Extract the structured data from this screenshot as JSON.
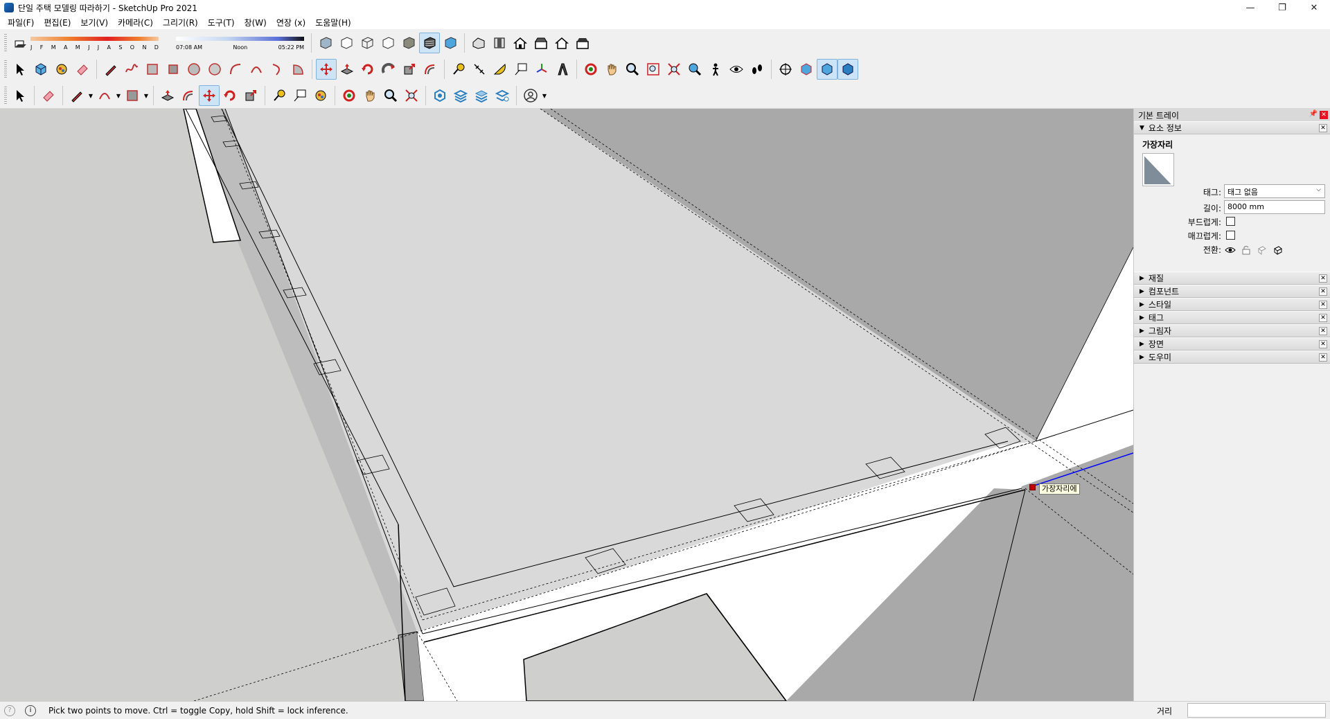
{
  "window": {
    "title": "단일 주택 모델링 따라하기 - SketchUp Pro 2021",
    "controls": {
      "minimize": "—",
      "restore": "❐",
      "close": "✕"
    }
  },
  "menu": [
    "파일(F)",
    "편집(E)",
    "보기(V)",
    "카메라(C)",
    "그리기(R)",
    "도구(T)",
    "창(W)",
    "연장 (x)",
    "도움말(H)"
  ],
  "shadow": {
    "months": [
      "J",
      "F",
      "M",
      "A",
      "M",
      "J",
      "J",
      "A",
      "S",
      "O",
      "N",
      "D"
    ],
    "time_start": "07:08 AM",
    "time_mid": "Noon",
    "time_end": "05:22 PM"
  },
  "tray": {
    "title": "기본 트레이",
    "entity_info": {
      "header": "요소 정보",
      "name": "가장자리",
      "tag_label": "태그:",
      "tag_value": "태그 없음",
      "length_label": "길이:",
      "length_value": "8000 mm",
      "soften_label": "부드럽게:",
      "smooth_label": "매끄럽게:",
      "toggle_label": "전환:"
    },
    "panels": [
      "재질",
      "컴포넌트",
      "스타일",
      "태그",
      "그림자",
      "장면",
      "도우미"
    ]
  },
  "viewport": {
    "inference_tooltip": "가장자리에"
  },
  "status": {
    "message": "Pick two points to move.  Ctrl = toggle Copy, hold Shift = lock inference.",
    "measurement_label": "거리",
    "measurement_value": ""
  },
  "colors": {
    "active_tool": "#cde4f7",
    "inference_point": "#c00000",
    "blue_axis": "#0000ff",
    "face_dark": "#a9a9a9",
    "face_light": "#d9d9d9"
  }
}
